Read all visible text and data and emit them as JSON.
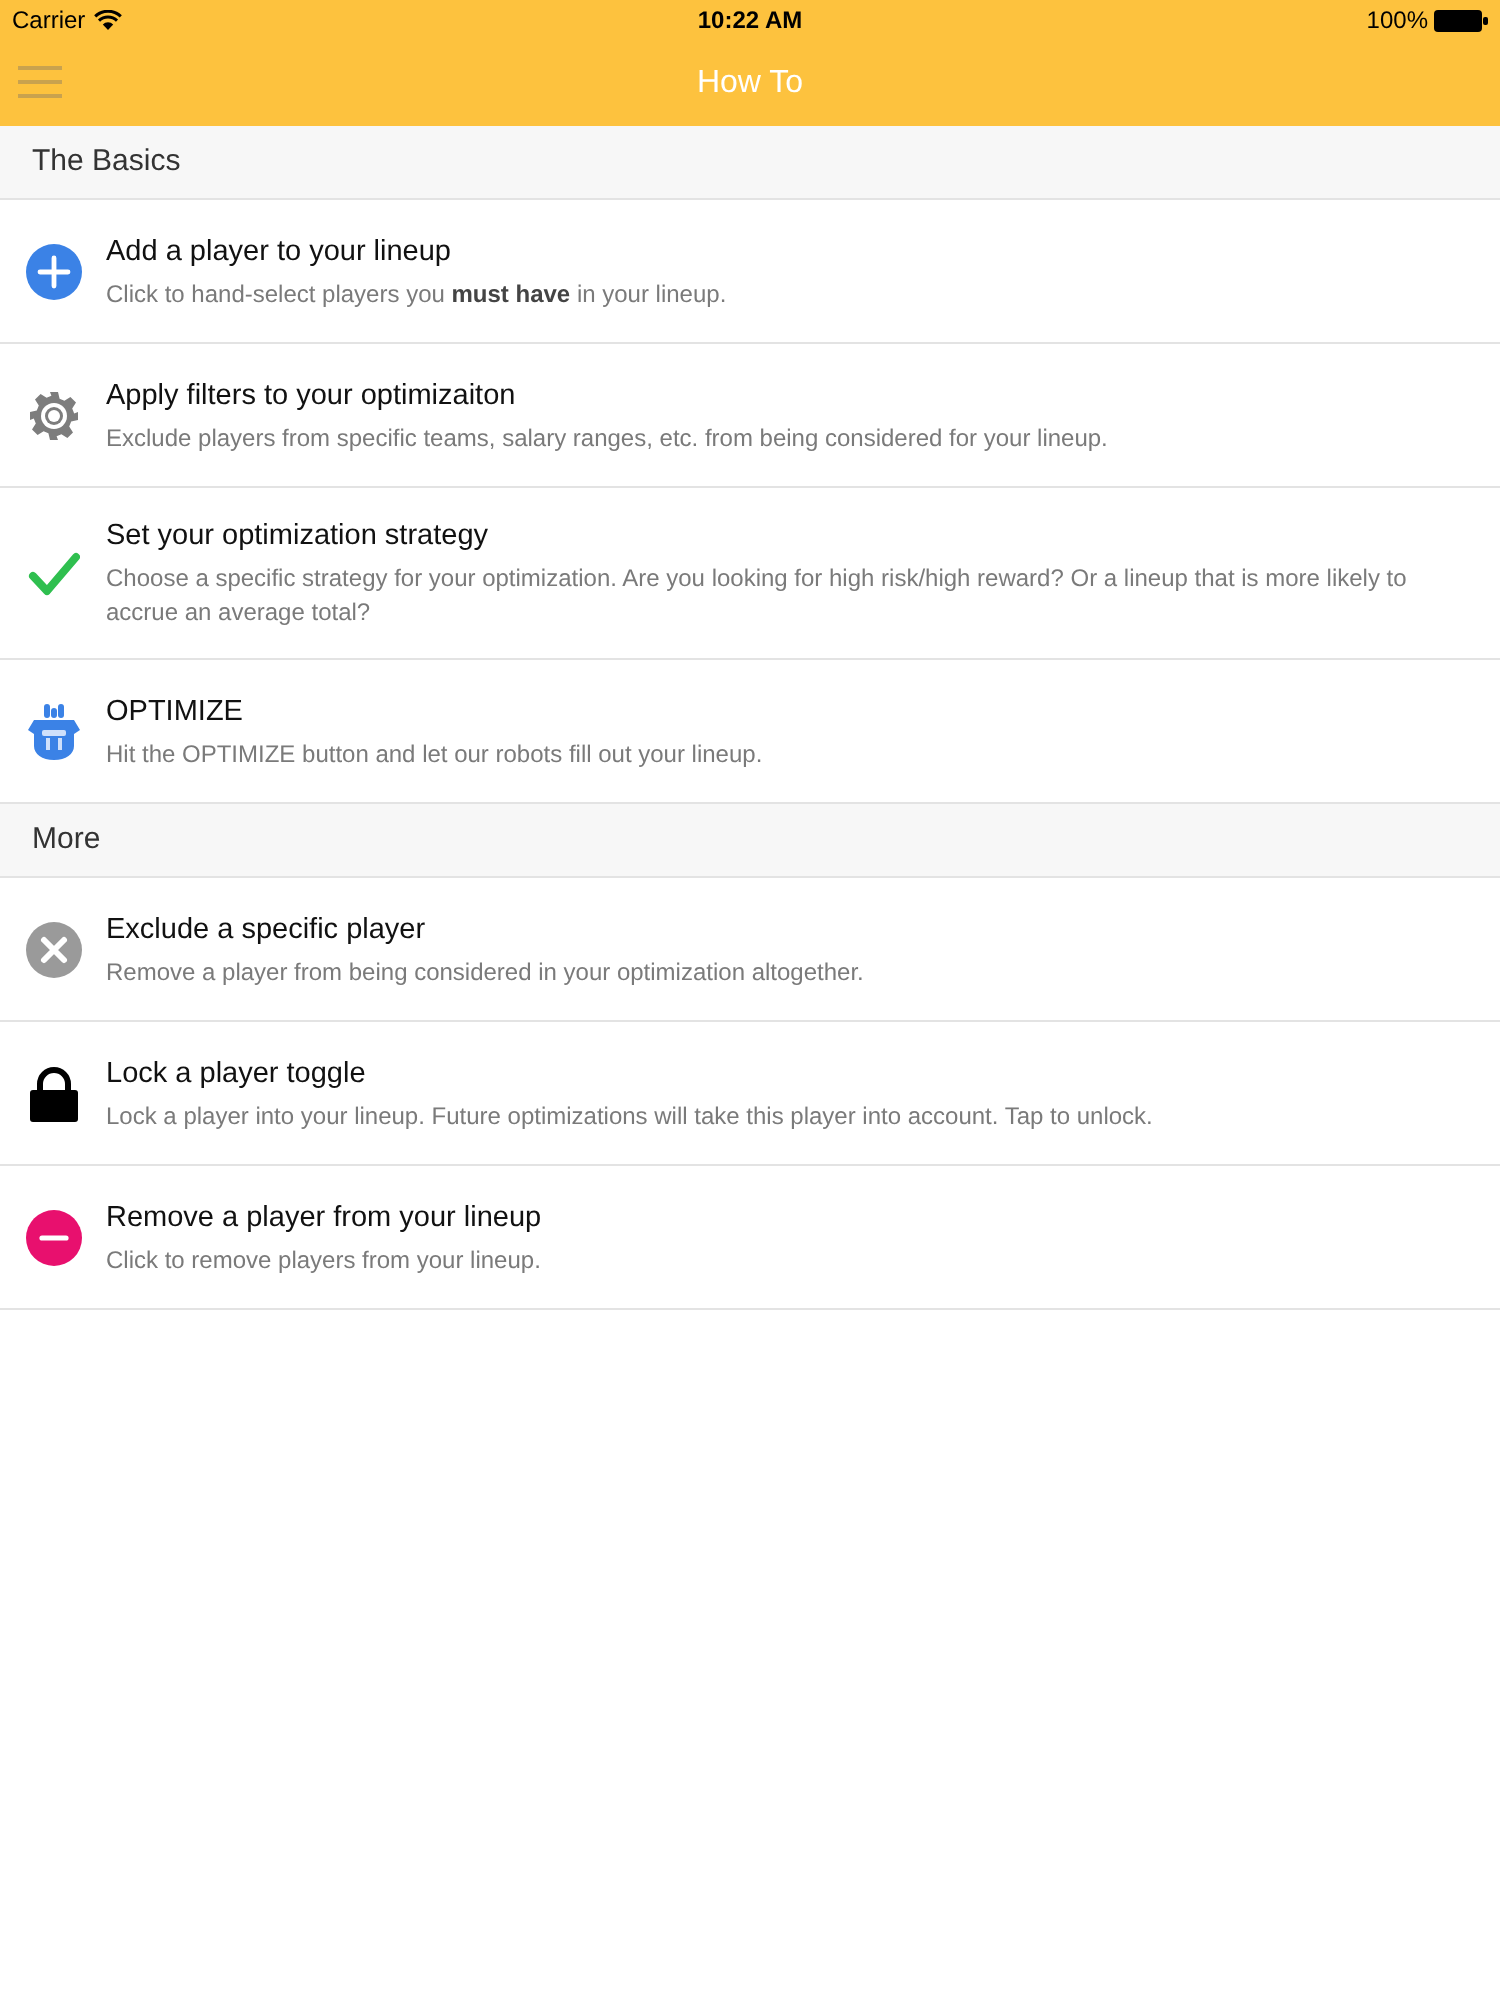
{
  "status_bar": {
    "carrier": "Carrier",
    "time": "10:22 AM",
    "battery": "100%"
  },
  "nav_bar": {
    "title": "How To"
  },
  "sections": [
    {
      "title": "The Basics",
      "items": [
        {
          "kind": "add",
          "title": "Add a player to your lineup",
          "description": "Click to hand-select players you **must have** in your lineup."
        },
        {
          "kind": "filter",
          "title": "Apply filters to your optimizaiton",
          "description": "Exclude players from specific teams, salary ranges, etc. from being considered for your lineup."
        },
        {
          "kind": "strategy",
          "title": "Set your optimization strategy",
          "description": "Choose a specific strategy for your optimization. Are you looking for high risk/high reward? Or a lineup that is more likely to accrue an average total?"
        },
        {
          "kind": "optimize",
          "title": "OPTIMIZE",
          "description": "Hit the OPTIMIZE button and let our robots fill out your lineup."
        }
      ]
    },
    {
      "title": "More",
      "items": [
        {
          "kind": "exclude",
          "title": "Exclude a specific player",
          "description": "Remove a player from being considered in your optimization altogether."
        },
        {
          "kind": "lock",
          "title": "Lock a player toggle",
          "description": "Lock a player into your lineup. Future optimizations will take this player into account. Tap to unlock."
        },
        {
          "kind": "remove",
          "title": "Remove a player from your lineup",
          "description": "Click to remove players from your lineup."
        }
      ]
    }
  ]
}
